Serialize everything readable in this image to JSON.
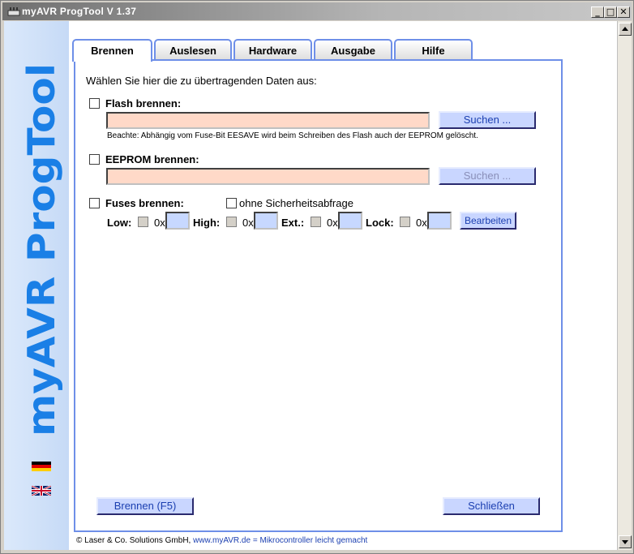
{
  "window": {
    "title": "myAVR ProgTool V 1.37"
  },
  "brand": {
    "text": "myAVR ProgTool",
    "color": "#1a7fe6"
  },
  "tabs": [
    {
      "label": "Brennen",
      "active": true
    },
    {
      "label": "Auslesen",
      "active": false
    },
    {
      "label": "Hardware",
      "active": false
    },
    {
      "label": "Ausgabe",
      "active": false
    },
    {
      "label": "Hilfe",
      "active": false
    }
  ],
  "main": {
    "instruction": "Wählen Sie hier die zu übertragenden Daten aus:",
    "flash": {
      "label": "Flash brennen:",
      "path_value": "",
      "search_label": "Suchen ...",
      "note": "Beachte: Abhängig vom Fuse-Bit EESAVE wird beim Schreiben des Flash auch der EEPROM gelöscht."
    },
    "eeprom": {
      "label": "EEPROM brennen:",
      "path_value": "",
      "search_label": "Suchen ..."
    },
    "fuses": {
      "label": "Fuses brennen:",
      "no_confirm_label": "ohne Sicherheitsabfrage",
      "low_label": "Low:",
      "high_label": "High:",
      "ext_label": "Ext.:",
      "lock_label": "Lock:",
      "hex_prefix": "0x",
      "edit_label": "Bearbeiten"
    },
    "burn_button": "Brennen (F5)",
    "close_button": "Schließen"
  },
  "footer": {
    "company": "© Laser & Co. Solutions GmbH,",
    "url": "www.myAVR.de",
    "slogan": "=  Mikrocontroller leicht gemacht"
  },
  "colors": {
    "tab_border": "#6e8fe8",
    "field_bg": "#ffd9c8",
    "button_bg": "#c9d6ff",
    "accent": "#1b3fb0"
  }
}
